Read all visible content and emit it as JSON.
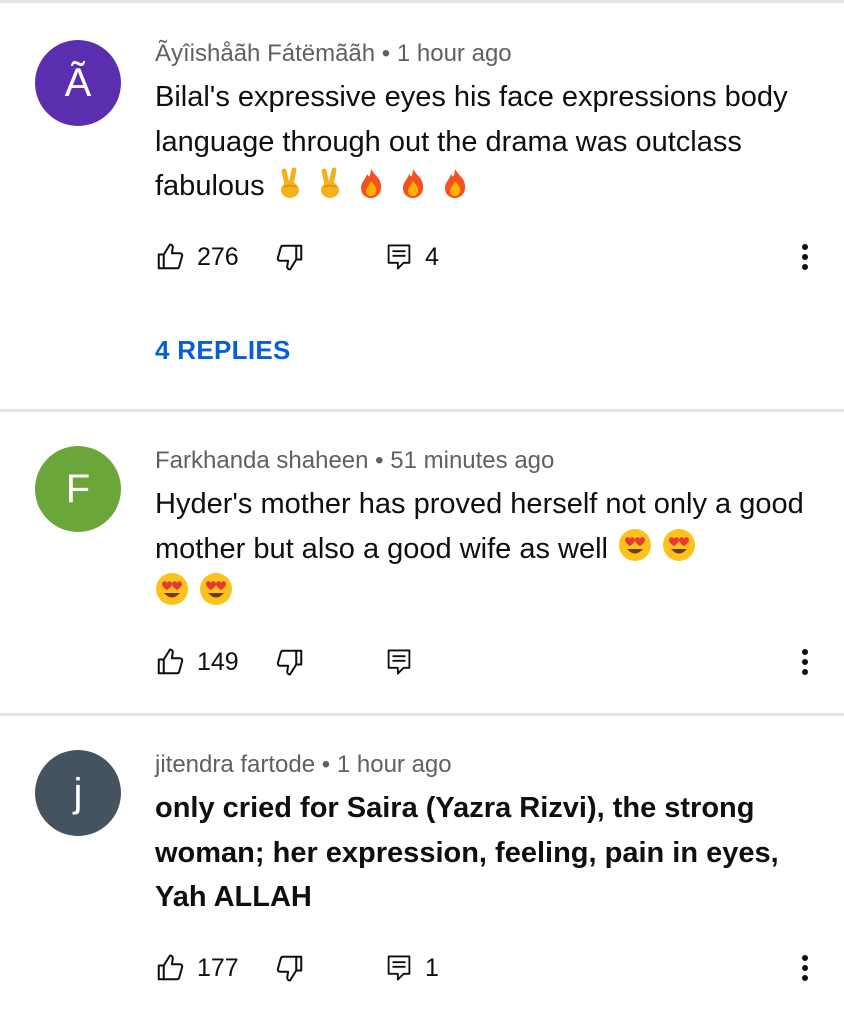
{
  "comments": [
    {
      "avatar_letter": "Ã",
      "avatar_color": "#5b2eb0",
      "author": "Ãyîishåãh Fátëmããh",
      "separator": "•",
      "time": "1 hour ago",
      "text": "Bilal's expressive eyes his face expressions body language through out the drama was outclass fabulous",
      "emojis": [
        "victory-hand",
        "victory-hand",
        "fire",
        "fire",
        "fire"
      ],
      "likes": "276",
      "replies_count": "4",
      "view_replies": "4 REPLIES"
    },
    {
      "avatar_letter": "F",
      "avatar_color": "#6aa63a",
      "author": "Farkhanda shaheen",
      "separator": "•",
      "time": "51 minutes ago",
      "text": "Hyder's mother has proved herself not only a good mother but also a good wife as well",
      "emojis": [
        "heart-eyes",
        "heart-eyes",
        "heart-eyes",
        "heart-eyes"
      ],
      "likes": "149",
      "replies_count": ""
    },
    {
      "avatar_letter": "j",
      "avatar_color": "#44535f",
      "author": "jitendra fartode",
      "separator": "•",
      "time": "1 hour ago",
      "text": "only cried for Saira (Yazra Rizvi), the strong woman; her expression, feeling, pain in eyes, Yah ALLAH",
      "emojis": [],
      "likes": "177",
      "replies_count": "1"
    }
  ],
  "colors": {
    "link_blue": "#065fd4",
    "meta_gray": "#606060",
    "divider": "#e6e6e6"
  }
}
